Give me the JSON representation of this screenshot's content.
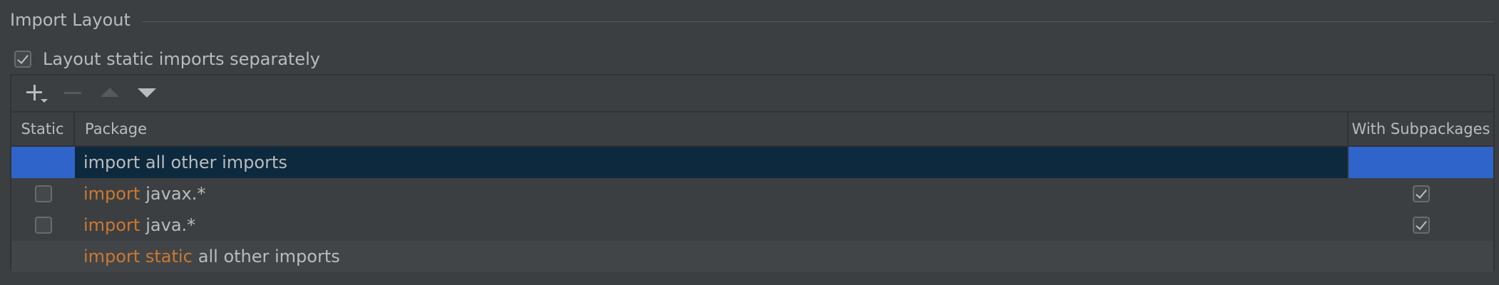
{
  "section": {
    "title": "Import Layout"
  },
  "layout_static_separately": {
    "label": "Layout static imports separately",
    "checked": true
  },
  "toolbar": {
    "add_icon": "plus-icon",
    "remove_icon": "minus-icon",
    "move_up_icon": "triangle-up-icon",
    "move_down_icon": "triangle-down-icon"
  },
  "table": {
    "headers": {
      "static": "Static",
      "package": "Package",
      "with_subpackages": "With Subpackages"
    },
    "rows": [
      {
        "keyword": "",
        "text": "import all other imports",
        "static_checkbox": false,
        "subpackages_checkbox": false
      },
      {
        "keyword": "import",
        "text": "javax.*",
        "static_checkbox": true,
        "static_checked": false,
        "subpackages_checkbox": true,
        "subpackages_checked": true
      },
      {
        "keyword": "import",
        "text": "java.*",
        "static_checkbox": true,
        "static_checked": false,
        "subpackages_checkbox": true,
        "subpackages_checked": true
      },
      {
        "keyword": "import static",
        "text": "all other imports",
        "static_checkbox": false,
        "subpackages_checkbox": false
      }
    ]
  },
  "colors": {
    "background": "#3c3f41",
    "selection_accent": "#2f65ca",
    "selection_row": "#0d293e",
    "keyword": "#cc7832",
    "text": "#bbbbbb"
  }
}
